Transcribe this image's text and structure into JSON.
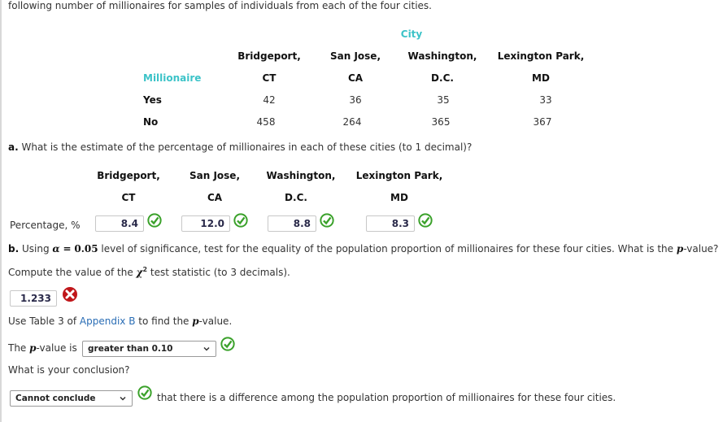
{
  "intro_text": "following number of millionaires for samples of individuals from each of the four cities.",
  "table": {
    "group_header": "City",
    "row_header_label": "Millionaire",
    "columns": [
      {
        "line1": "Bridgeport,",
        "line2": "CT"
      },
      {
        "line1": "San Jose,",
        "line2": "CA"
      },
      {
        "line1": "Washington,",
        "line2": "D.C."
      },
      {
        "line1": "Lexington Park,",
        "line2": "MD"
      }
    ],
    "rows": [
      {
        "label": "Yes",
        "values": [
          "42",
          "36",
          "35",
          "33"
        ]
      },
      {
        "label": "No",
        "values": [
          "458",
          "264",
          "365",
          "367"
        ]
      }
    ]
  },
  "part_a": {
    "label": "a.",
    "question": "What is the estimate of the percentage of millionaires in each of these cities (to 1 decimal)?",
    "columns": [
      {
        "line1": "Bridgeport,",
        "line2": "CT"
      },
      {
        "line1": "San Jose,",
        "line2": "CA"
      },
      {
        "line1": "Washington,",
        "line2": "D.C."
      },
      {
        "line1": "Lexington Park,",
        "line2": "MD"
      }
    ],
    "row_label": "Percentage, %",
    "answers": [
      {
        "value": "8.4",
        "status": "correct"
      },
      {
        "value": "12.0",
        "status": "correct"
      },
      {
        "value": "8.8",
        "status": "correct"
      },
      {
        "value": "8.3",
        "status": "correct"
      }
    ]
  },
  "part_b": {
    "label": "b.",
    "q_using": "Using",
    "alpha_symbol": "α",
    "equals": "=",
    "alpha_value": "0.05",
    "q_rest": "level of significance, test for the equality of the population proportion of millionaires for these four cities. What is the",
    "p_symbol": "p",
    "q_end": "-value?",
    "compute_prefix": "Compute the value of the",
    "chi_symbol": "χ",
    "chi_sup": "2",
    "compute_suffix": "test statistic (to 3 decimals).",
    "chi_answer": {
      "value": "1.233",
      "status": "incorrect"
    },
    "table_prefix": "Use Table 3 of",
    "table_link": "Appendix B",
    "table_mid": "to find the",
    "table_p": "p",
    "table_suffix": "-value.",
    "pvalue_prefix": "The",
    "pvalue_p": "p",
    "pvalue_mid": "-value is",
    "pvalue_selected": "greater than 0.10",
    "pvalue_status": "correct",
    "conclusion_question": "What is your conclusion?",
    "conclusion_selected": "Cannot conclude",
    "conclusion_status": "correct",
    "conclusion_suffix": "that there is a difference among the population proportion of millionaires for these four cities."
  },
  "colors": {
    "teal_header": "#3cc3c8",
    "link": "#2a6db5",
    "correct_green": "#3aa12a",
    "incorrect_red": "#c0161a"
  }
}
